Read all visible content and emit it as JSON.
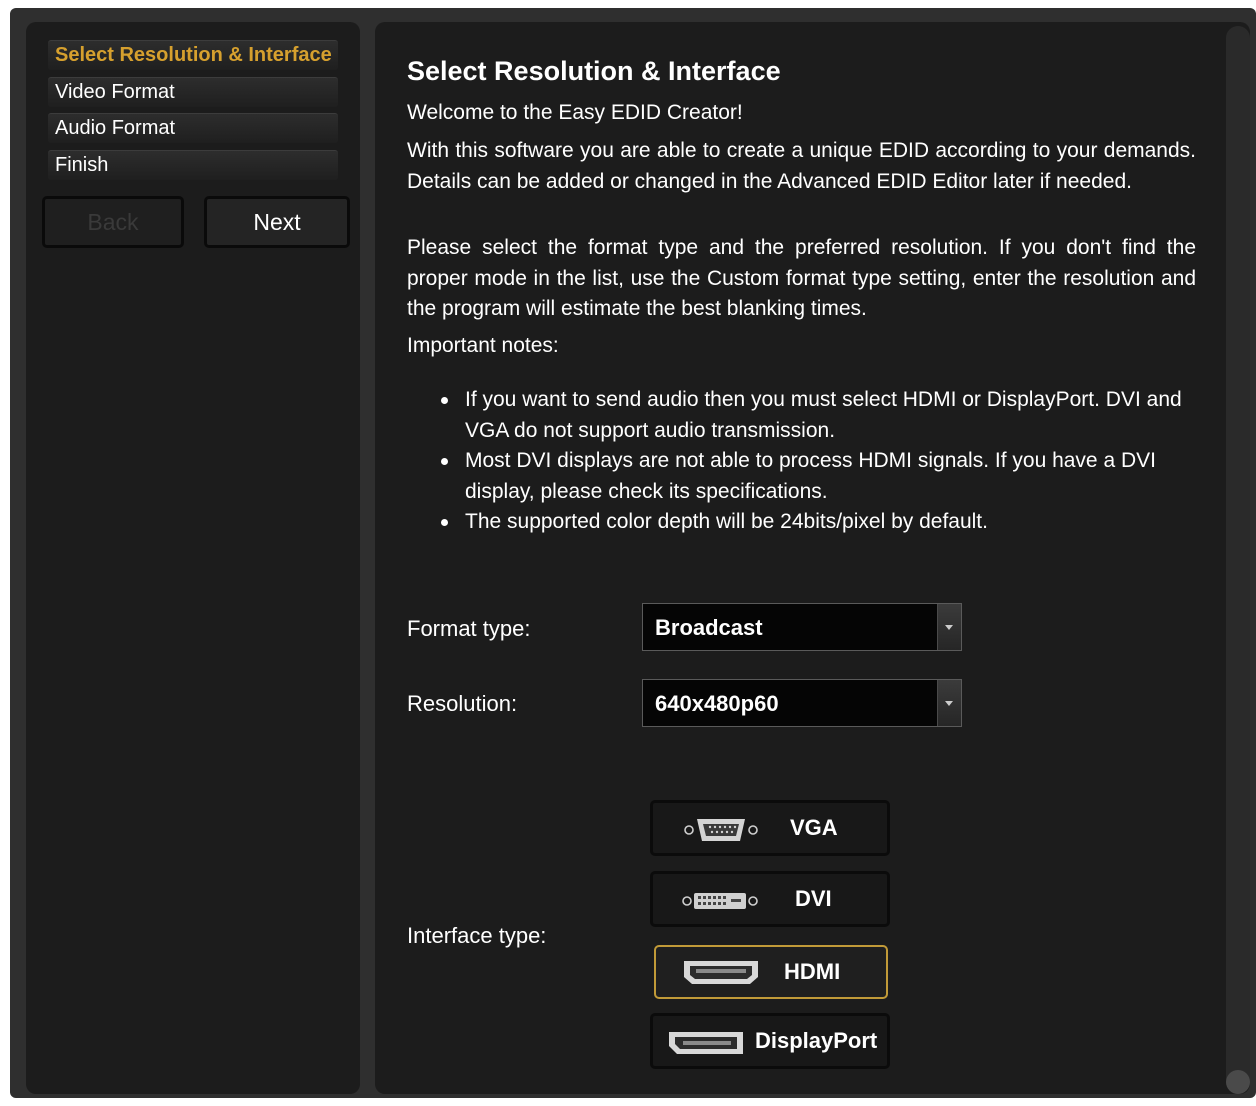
{
  "sidebar": {
    "steps": [
      {
        "label": "Select Resolution & Interface"
      },
      {
        "label": "Video Format"
      },
      {
        "label": "Audio Format"
      },
      {
        "label": "Finish"
      }
    ],
    "back_label": "Back",
    "next_label": "Next"
  },
  "main": {
    "title": "Select Resolution & Interface",
    "welcome": "Welcome to the Easy EDID Creator!",
    "intro": "With this software you are able to create a unique EDID according to your demands. Details can be added or changed in the Advanced EDID Editor later if needed.",
    "instructions": "Please select the format type and the preferred resolution. If you don't find the proper mode in the list, use the Custom format type setting, enter the resolution and the program will estimate the best blanking times.",
    "notes_heading": "Important notes:",
    "notes": [
      "If you want to send audio then you must select HDMI or DisplayPort. DVI and VGA do not support audio transmission.",
      "Most DVI displays are not able to process HDMI signals. If you have a DVI display, please check its specifications.",
      "The supported color depth will be 24bits/pixel by default."
    ],
    "format_type_label": "Format type:",
    "format_type_value": "Broadcast",
    "resolution_label": "Resolution:",
    "resolution_value": "640x480p60",
    "interface_type_label": "Interface type:",
    "interfaces": [
      {
        "label": "VGA",
        "icon": "vga-connector-icon"
      },
      {
        "label": "DVI",
        "icon": "dvi-connector-icon"
      },
      {
        "label": "HDMI",
        "icon": "hdmi-connector-icon"
      },
      {
        "label": "DisplayPort",
        "icon": "displayport-connector-icon"
      }
    ],
    "selected_interface": "HDMI"
  },
  "colors": {
    "accent": "#d6a02e",
    "panel_background": "#1c1c1c",
    "frame_background": "#2f2f2f",
    "selected_border": "#c19a38"
  }
}
